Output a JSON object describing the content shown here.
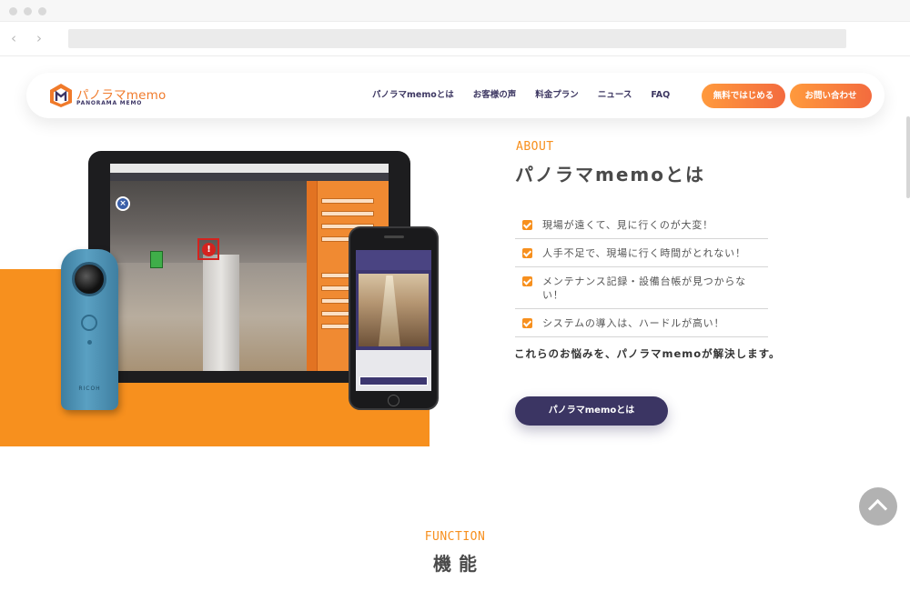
{
  "header": {
    "logo_text": "パノラマmemo",
    "logo_sub": "PANORAMA MEMO",
    "nav": [
      "パノラマmemoとは",
      "お客様の声",
      "料金プラン",
      "ニュース",
      "FAQ"
    ],
    "cta_free": "無料ではじめる",
    "cta_contact": "お問い合わせ"
  },
  "about": {
    "label": "ABOUT",
    "title": "パノラマmemoとは",
    "problems": [
      "現場が遠くて、見に行くのが大変！",
      "人手不足で、現場に行く時間がとれない！",
      "メンテナンス記録・設備台帳が見つからない！",
      "システムの導入は、ハードルが高い！"
    ],
    "solution": "これらのお悩みを、パノラマmemoが解決します。",
    "button": "パノラマmemoとは"
  },
  "hero": {
    "camera_brand": "RICOH",
    "warning_glyph": "!",
    "close_glyph": "×"
  },
  "function": {
    "label": "FUNCTION",
    "title": "機能"
  },
  "colors": {
    "accent": "#f7901e",
    "brand_dark": "#3b3563",
    "button_gradient_start": "#ff9a3d",
    "button_gradient_end": "#f36b3e"
  },
  "icons": {
    "back": "chevron-left-icon",
    "forward": "chevron-right-icon",
    "check": "check-icon",
    "page_top": "chevron-up-icon"
  }
}
